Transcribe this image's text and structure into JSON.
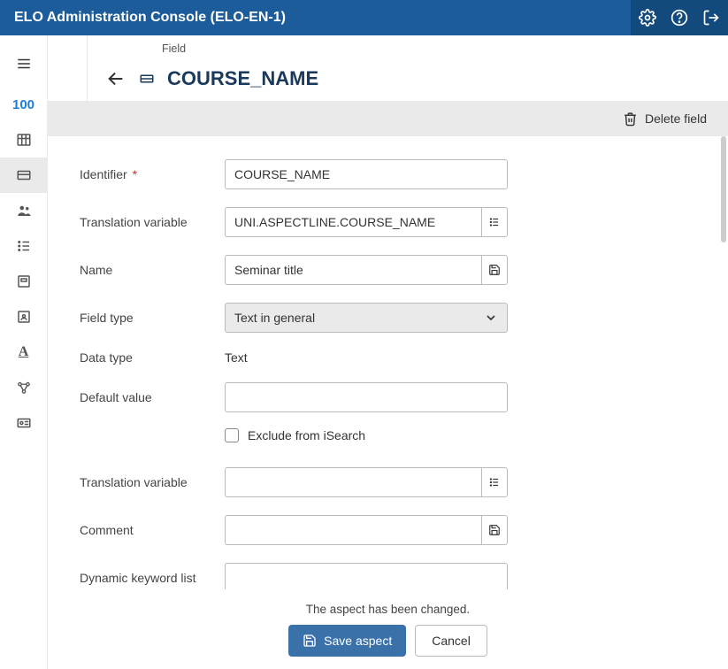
{
  "header": {
    "title": "ELO Administration Console (ELO-EN-1)"
  },
  "sidebar": {
    "active_number": "100"
  },
  "breadcrumb": {
    "label": "Field"
  },
  "page": {
    "title": "COURSE_NAME"
  },
  "actions": {
    "delete": "Delete field"
  },
  "form": {
    "identifier": {
      "label": "Identifier",
      "value": "COURSE_NAME",
      "required": "*"
    },
    "translation_var1": {
      "label": "Translation variable",
      "value": "UNI.ASPECTLINE.COURSE_NAME"
    },
    "name": {
      "label": "Name",
      "value": "Seminar title"
    },
    "field_type": {
      "label": "Field type",
      "value": "Text in general"
    },
    "data_type": {
      "label": "Data type",
      "value": "Text"
    },
    "default_value": {
      "label": "Default value",
      "value": ""
    },
    "exclude_isearch": {
      "label": "Exclude from iSearch"
    },
    "translation_var2": {
      "label": "Translation variable",
      "value": ""
    },
    "comment": {
      "label": "Comment",
      "value": ""
    },
    "dyn_keyword": {
      "label": "Dynamic keyword list",
      "value": ""
    }
  },
  "footer": {
    "status": "The aspect has been changed.",
    "save": "Save aspect",
    "cancel": "Cancel"
  }
}
